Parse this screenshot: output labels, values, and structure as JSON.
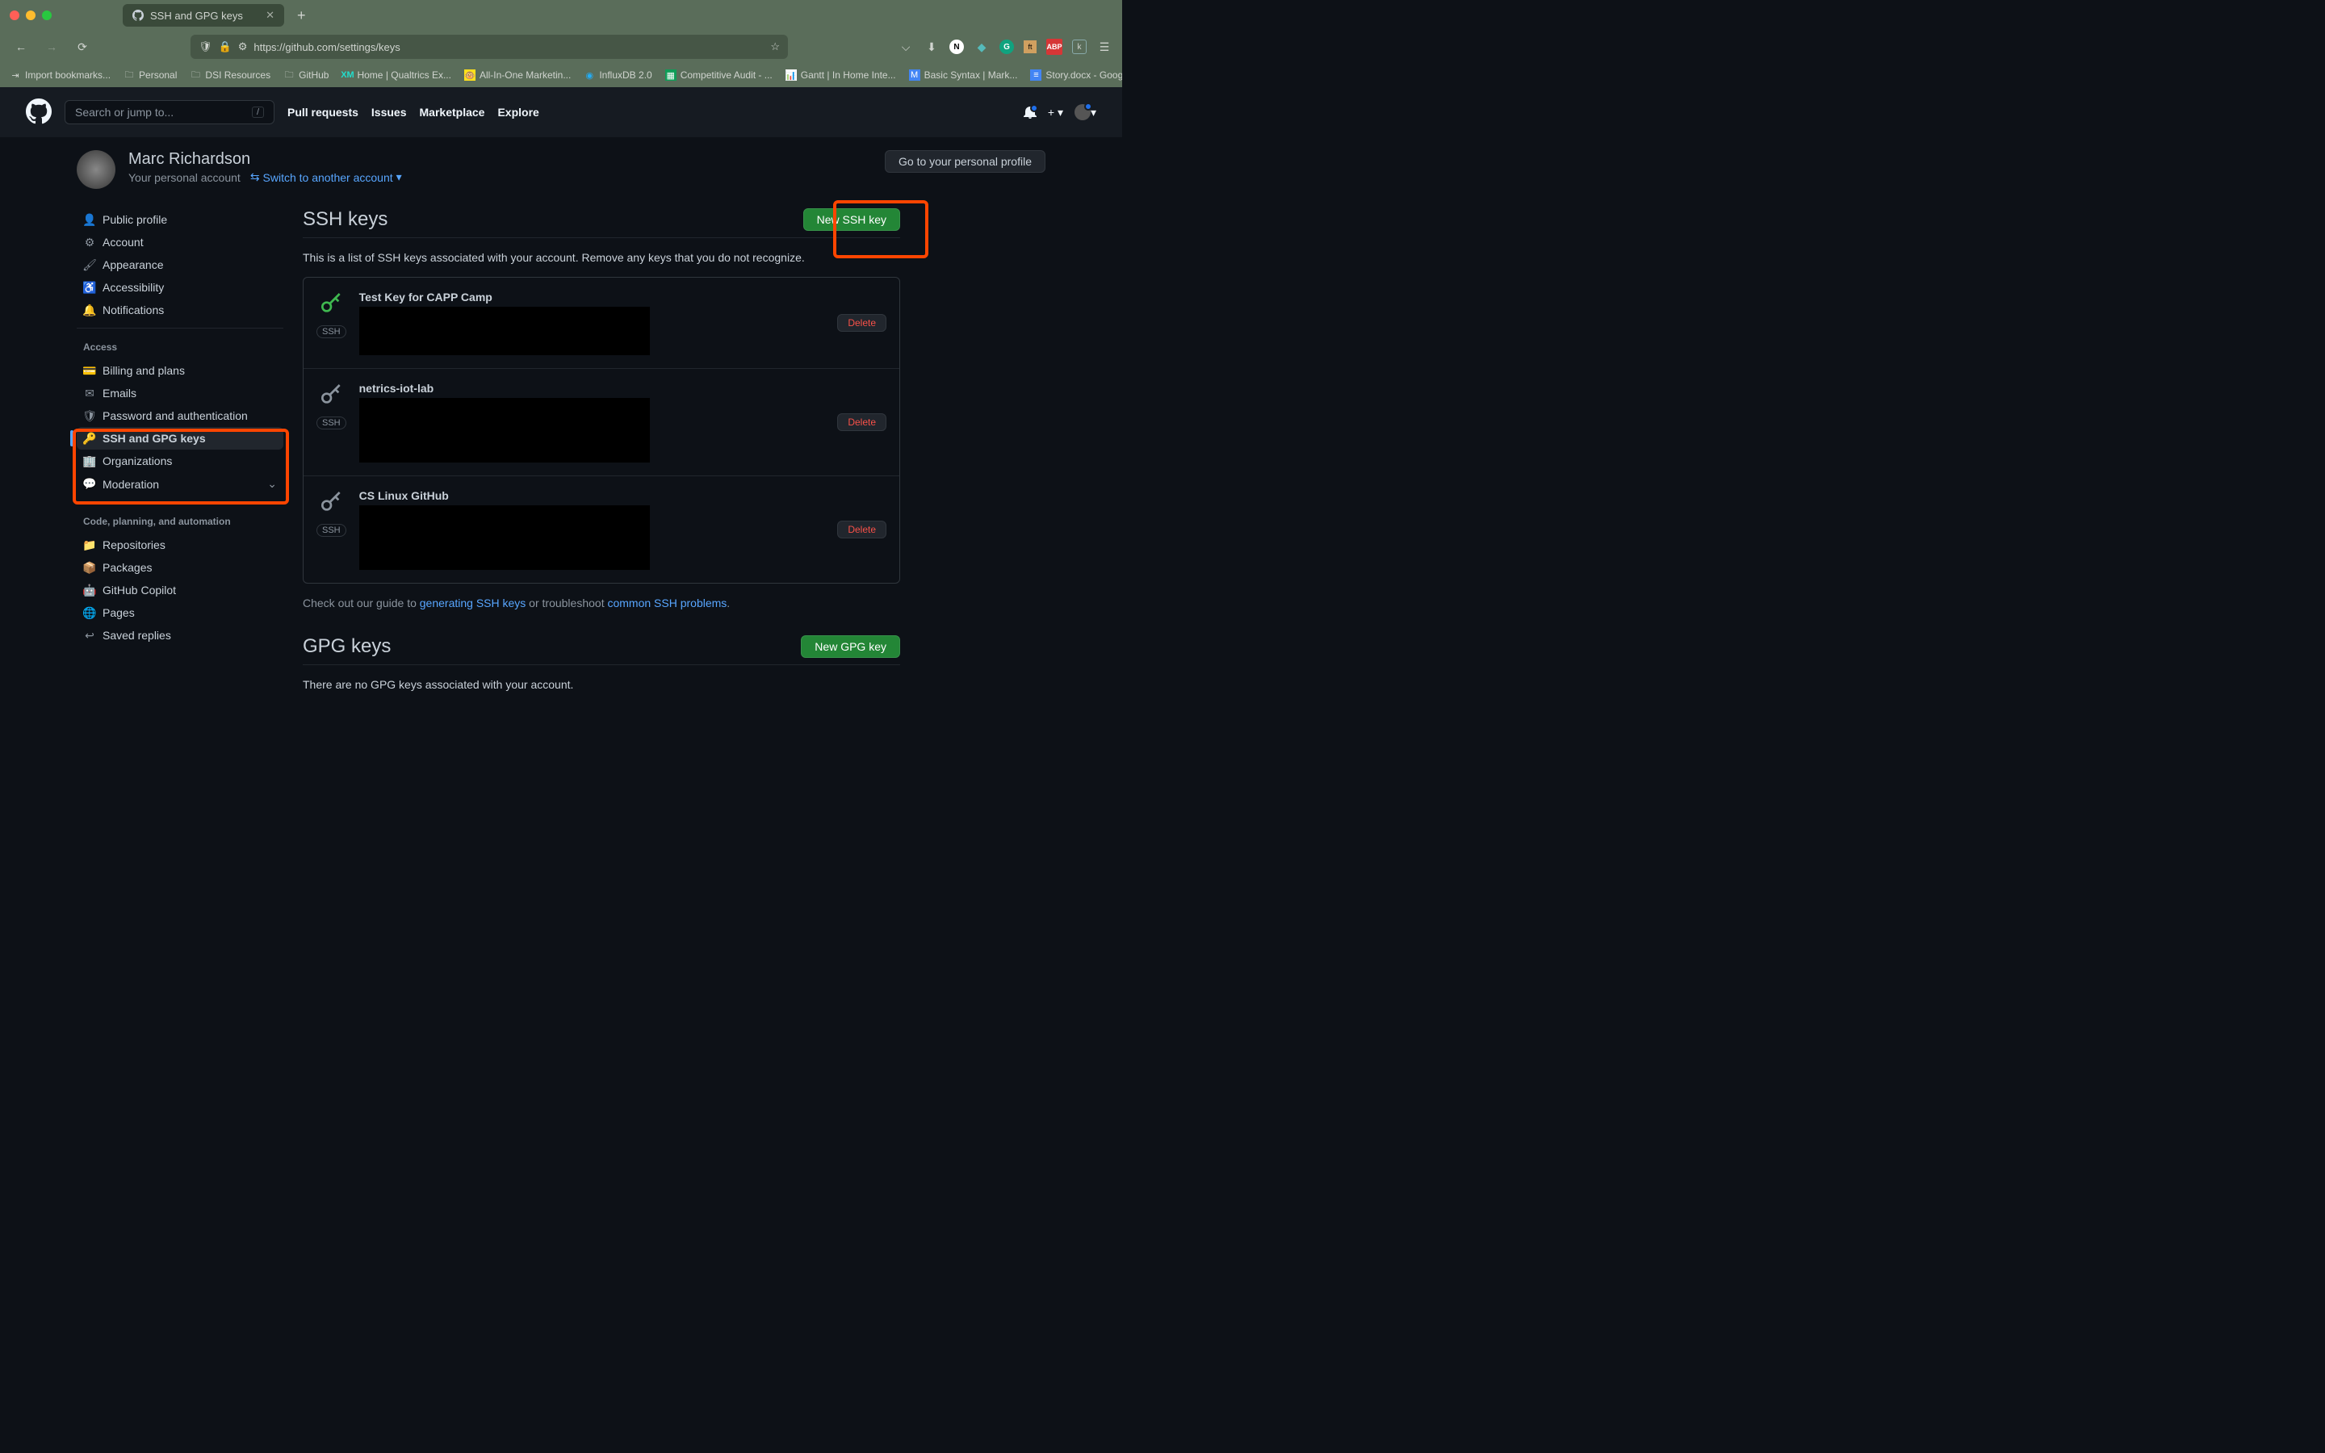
{
  "browser": {
    "tab_title": "SSH and GPG keys",
    "url": "https://github.com/settings/keys",
    "bookmarks": [
      {
        "label": "Import bookmarks...",
        "type": "import"
      },
      {
        "label": "Personal",
        "type": "folder"
      },
      {
        "label": "DSI Resources",
        "type": "folder"
      },
      {
        "label": "GitHub",
        "type": "folder"
      },
      {
        "label": "Home | Qualtrics Ex...",
        "type": "xm"
      },
      {
        "label": "All-In-One Marketin...",
        "type": "mc"
      },
      {
        "label": "InfluxDB 2.0",
        "type": "influx"
      },
      {
        "label": "Competitive Audit - ...",
        "type": "sheets"
      },
      {
        "label": "Gantt | In Home Inte...",
        "type": "gantt"
      },
      {
        "label": "Basic Syntax | Mark...",
        "type": "md"
      },
      {
        "label": "Story.docx - Google...",
        "type": "docs"
      }
    ]
  },
  "github": {
    "search_placeholder": "Search or jump to...",
    "nav": [
      "Pull requests",
      "Issues",
      "Marketplace",
      "Explore"
    ],
    "profile": {
      "name": "Marc Richardson",
      "subtitle": "Your personal account",
      "switch_label": "Switch to another account",
      "goto_btn": "Go to your personal profile"
    },
    "sidebar": {
      "top": [
        {
          "label": "Public profile"
        },
        {
          "label": "Account"
        },
        {
          "label": "Appearance"
        },
        {
          "label": "Accessibility"
        },
        {
          "label": "Notifications"
        }
      ],
      "access_heading": "Access",
      "access": [
        {
          "label": "Billing and plans"
        },
        {
          "label": "Emails"
        },
        {
          "label": "Password and authentication"
        },
        {
          "label": "SSH and GPG keys",
          "active": true
        },
        {
          "label": "Organizations"
        },
        {
          "label": "Moderation",
          "chevron": true
        }
      ],
      "code_heading": "Code, planning, and automation",
      "code": [
        {
          "label": "Repositories"
        },
        {
          "label": "Packages"
        },
        {
          "label": "GitHub Copilot"
        },
        {
          "label": "Pages"
        },
        {
          "label": "Saved replies"
        }
      ]
    },
    "ssh": {
      "title": "SSH keys",
      "new_btn": "New SSH key",
      "desc": "This is a list of SSH keys associated with your account. Remove any keys that you do not recognize.",
      "keys": [
        {
          "name": "Test Key for CAPP Camp",
          "badge": "SSH",
          "color": "green",
          "delete": "Delete"
        },
        {
          "name": "netrics-iot-lab",
          "badge": "SSH",
          "color": "gray",
          "delete": "Delete"
        },
        {
          "name": "CS Linux GitHub",
          "badge": "SSH",
          "color": "gray",
          "delete": "Delete"
        }
      ],
      "guide_pre": "Check out our guide to ",
      "guide_link1": "generating SSH keys",
      "guide_mid": " or troubleshoot ",
      "guide_link2": "common SSH problems",
      "guide_post": "."
    },
    "gpg": {
      "title": "GPG keys",
      "new_btn": "New GPG key",
      "desc": "There are no GPG keys associated with your account."
    }
  }
}
